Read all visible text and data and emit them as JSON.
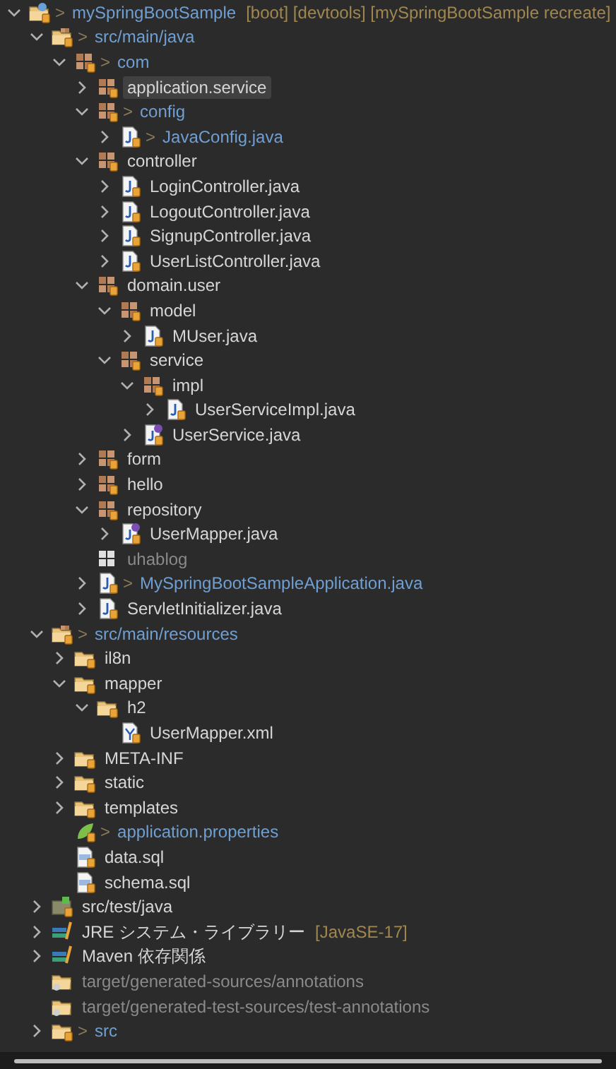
{
  "tree": [
    {
      "label": "mySpringBootSample",
      "kind": "project",
      "marker": ">",
      "decoration": "[boot] [devtools] [mySpringBootSample recreate]",
      "modified": true,
      "dimmed": false,
      "selected": false,
      "expanded": true,
      "children": [
        {
          "label": "src/main/java",
          "kind": "source-folder",
          "marker": ">",
          "modified": true,
          "dimmed": false,
          "selected": false,
          "expanded": true,
          "children": [
            {
              "label": "com",
              "kind": "package",
              "marker": ">",
              "modified": true,
              "dimmed": false,
              "selected": false,
              "expanded": true,
              "children": [
                {
                  "label": "application.service",
                  "kind": "package",
                  "modified": false,
                  "dimmed": false,
                  "selected": true,
                  "expanded": false
                },
                {
                  "label": "config",
                  "kind": "package",
                  "marker": ">",
                  "modified": true,
                  "dimmed": false,
                  "selected": false,
                  "expanded": true,
                  "children": [
                    {
                      "label": "JavaConfig.java",
                      "kind": "java-class",
                      "marker": ">",
                      "modified": true,
                      "dimmed": false,
                      "selected": false,
                      "expanded": false
                    }
                  ]
                },
                {
                  "label": "controller",
                  "kind": "package",
                  "modified": false,
                  "dimmed": false,
                  "selected": false,
                  "expanded": true,
                  "children": [
                    {
                      "label": "LoginController.java",
                      "kind": "java-class",
                      "modified": false,
                      "dimmed": false,
                      "selected": false,
                      "expanded": false
                    },
                    {
                      "label": "LogoutController.java",
                      "kind": "java-class",
                      "modified": false,
                      "dimmed": false,
                      "selected": false,
                      "expanded": false
                    },
                    {
                      "label": "SignupController.java",
                      "kind": "java-class",
                      "modified": false,
                      "dimmed": false,
                      "selected": false,
                      "expanded": false
                    },
                    {
                      "label": "UserListController.java",
                      "kind": "java-class",
                      "modified": false,
                      "dimmed": false,
                      "selected": false,
                      "expanded": false
                    }
                  ]
                },
                {
                  "label": "domain.user",
                  "kind": "package",
                  "modified": false,
                  "dimmed": false,
                  "selected": false,
                  "expanded": true,
                  "children": [
                    {
                      "label": "model",
                      "kind": "package",
                      "modified": false,
                      "dimmed": false,
                      "selected": false,
                      "expanded": true,
                      "children": [
                        {
                          "label": "MUser.java",
                          "kind": "java-class",
                          "modified": false,
                          "dimmed": false,
                          "selected": false,
                          "expanded": false
                        }
                      ]
                    },
                    {
                      "label": "service",
                      "kind": "package",
                      "modified": false,
                      "dimmed": false,
                      "selected": false,
                      "expanded": true,
                      "children": [
                        {
                          "label": "impl",
                          "kind": "package",
                          "modified": false,
                          "dimmed": false,
                          "selected": false,
                          "expanded": true,
                          "children": [
                            {
                              "label": "UserServiceImpl.java",
                              "kind": "java-class",
                              "modified": false,
                              "dimmed": false,
                              "selected": false,
                              "expanded": false
                            }
                          ]
                        },
                        {
                          "label": "UserService.java",
                          "kind": "java-interface",
                          "modified": false,
                          "dimmed": false,
                          "selected": false,
                          "expanded": false
                        }
                      ]
                    }
                  ]
                },
                {
                  "label": "form",
                  "kind": "package",
                  "modified": false,
                  "dimmed": false,
                  "selected": false,
                  "expanded": false
                },
                {
                  "label": "hello",
                  "kind": "package",
                  "modified": false,
                  "dimmed": false,
                  "selected": false,
                  "expanded": false
                },
                {
                  "label": "repository",
                  "kind": "package",
                  "modified": false,
                  "dimmed": false,
                  "selected": false,
                  "expanded": true,
                  "children": [
                    {
                      "label": "UserMapper.java",
                      "kind": "java-interface",
                      "modified": false,
                      "dimmed": false,
                      "selected": false,
                      "expanded": false
                    }
                  ]
                },
                {
                  "label": "uhablog",
                  "kind": "empty-package",
                  "modified": false,
                  "dimmed": true,
                  "selected": false
                },
                {
                  "label": "MySpringBootSampleApplication.java",
                  "kind": "java-class",
                  "marker": ">",
                  "modified": true,
                  "dimmed": false,
                  "selected": false,
                  "expanded": false
                },
                {
                  "label": "ServletInitializer.java",
                  "kind": "java-class",
                  "modified": false,
                  "dimmed": false,
                  "selected": false,
                  "expanded": false
                }
              ]
            }
          ]
        },
        {
          "label": "src/main/resources",
          "kind": "source-folder",
          "marker": ">",
          "modified": true,
          "dimmed": false,
          "selected": false,
          "expanded": true,
          "children": [
            {
              "label": "il8n",
              "kind": "folder",
              "modified": false,
              "dimmed": false,
              "selected": false,
              "expanded": false
            },
            {
              "label": "mapper",
              "kind": "folder",
              "modified": false,
              "dimmed": false,
              "selected": false,
              "expanded": true,
              "children": [
                {
                  "label": "h2",
                  "kind": "folder",
                  "modified": false,
                  "dimmed": false,
                  "selected": false,
                  "expanded": true,
                  "children": [
                    {
                      "label": "UserMapper.xml",
                      "kind": "xml-file",
                      "modified": false,
                      "dimmed": false,
                      "selected": false
                    }
                  ]
                }
              ]
            },
            {
              "label": "META-INF",
              "kind": "folder",
              "modified": false,
              "dimmed": false,
              "selected": false,
              "expanded": false
            },
            {
              "label": "static",
              "kind": "folder",
              "modified": false,
              "dimmed": false,
              "selected": false,
              "expanded": false
            },
            {
              "label": "templates",
              "kind": "folder",
              "modified": false,
              "dimmed": false,
              "selected": false,
              "expanded": false
            },
            {
              "label": "application.properties",
              "kind": "properties-file",
              "marker": ">",
              "modified": true,
              "dimmed": false,
              "selected": false
            },
            {
              "label": "data.sql",
              "kind": "sql-file",
              "modified": false,
              "dimmed": false,
              "selected": false
            },
            {
              "label": "schema.sql",
              "kind": "sql-file",
              "modified": false,
              "dimmed": false,
              "selected": false
            }
          ]
        },
        {
          "label": "src/test/java",
          "kind": "test-folder",
          "modified": false,
          "dimmed": false,
          "selected": false,
          "expanded": false
        },
        {
          "label": "JRE システム・ライブラリー",
          "kind": "library",
          "decoration": "[JavaSE-17]",
          "modified": false,
          "dimmed": false,
          "selected": false,
          "expanded": false
        },
        {
          "label": "Maven 依存関係",
          "kind": "library",
          "modified": false,
          "dimmed": false,
          "selected": false,
          "expanded": false
        },
        {
          "label": "target/generated-sources/annotations",
          "kind": "generated-folder",
          "modified": false,
          "dimmed": true,
          "selected": false
        },
        {
          "label": "target/generated-test-sources/test-annotations",
          "kind": "generated-folder",
          "modified": false,
          "dimmed": true,
          "selected": false
        },
        {
          "label": "src",
          "kind": "folder",
          "marker": ">",
          "modified": true,
          "dimmed": false,
          "selected": false,
          "expanded": false
        }
      ]
    }
  ]
}
